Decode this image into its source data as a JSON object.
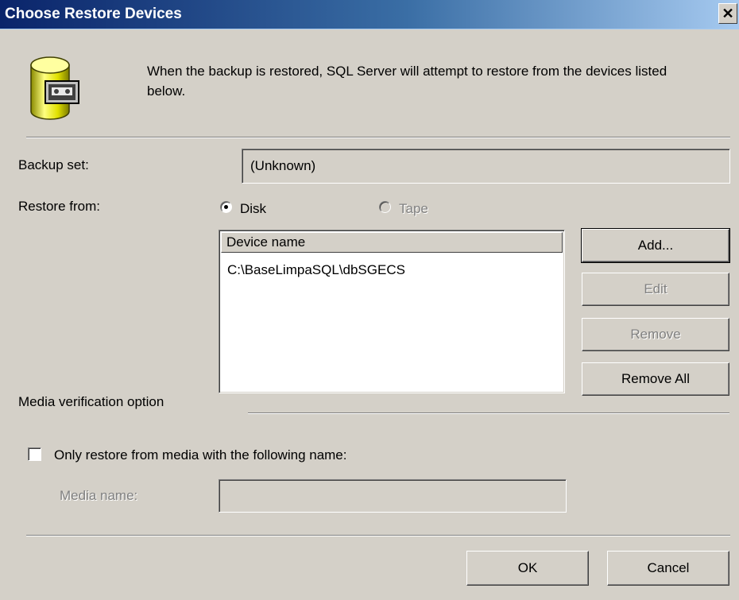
{
  "window": {
    "title": "Choose Restore Devices",
    "close_glyph": "✕"
  },
  "intro": {
    "icon": "database-tape-icon",
    "text": "When the backup is restored, SQL Server will attempt to restore from the devices listed below."
  },
  "backup_set": {
    "label": "Backup set:",
    "value": "(Unknown)"
  },
  "restore_from": {
    "label": "Restore from:",
    "options": [
      {
        "label": "Disk",
        "selected": true,
        "enabled": true
      },
      {
        "label": "Tape",
        "selected": false,
        "enabled": false
      }
    ]
  },
  "device_list": {
    "header": "Device name",
    "items": [
      "C:\\BaseLimpaSQL\\dbSGECS"
    ]
  },
  "device_buttons": {
    "add": "Add...",
    "edit": "Edit",
    "remove": "Remove",
    "remove_all": "Remove All"
  },
  "media_verification": {
    "group_label": "Media verification option",
    "checkbox_label": "Only restore from media with the following name:",
    "checked": false,
    "media_name_label": "Media name:",
    "media_name_value": ""
  },
  "footer": {
    "ok": "OK",
    "cancel": "Cancel"
  }
}
